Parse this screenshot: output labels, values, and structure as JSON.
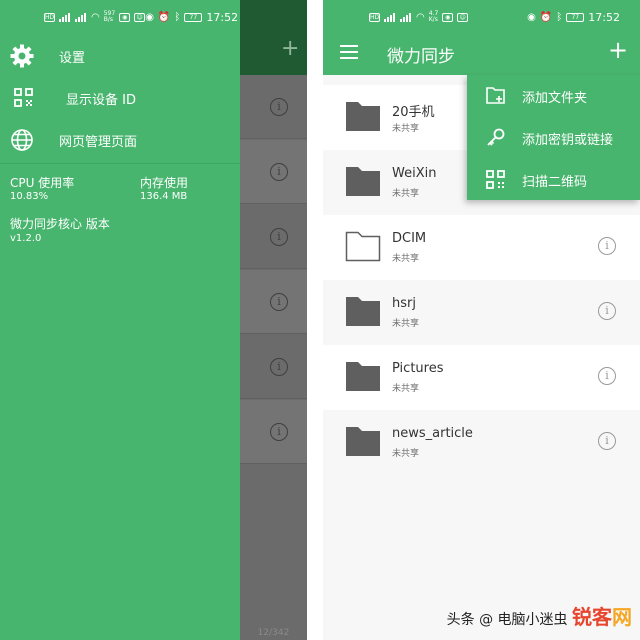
{
  "left_phone": {
    "status_bar": {
      "network_speed": "597\nB/s",
      "battery": "77",
      "time": "17:52"
    },
    "drawer": {
      "menu_items": [
        {
          "icon": "gear-icon",
          "label": "设置"
        },
        {
          "icon": "qr-code-icon",
          "label": "显示设备 ID"
        },
        {
          "icon": "globe-icon",
          "label": "网页管理页面"
        }
      ],
      "stats": {
        "cpu_label": "CPU 使用率",
        "cpu_value": "10.83%",
        "memory_label": "内存使用",
        "memory_value": "136.4 MB",
        "core_label": "微力同步核心 版本",
        "core_value": "v1.2.0"
      }
    },
    "background": {
      "plus_icon": "+",
      "info_icon": "i",
      "page_indicator": "12/342"
    }
  },
  "right_phone": {
    "status_bar": {
      "network_speed": "4.7\nK/s",
      "battery": "77",
      "time": "17:52"
    },
    "app_bar": {
      "title": "微力同步",
      "menu_icon": "hamburger-icon",
      "add_icon": "+"
    },
    "popup_menu": [
      {
        "icon": "add-folder-icon",
        "label": "添加文件夹"
      },
      {
        "icon": "key-icon",
        "label": "添加密钥或链接"
      },
      {
        "icon": "qr-scan-icon",
        "label": "扫描二维码"
      }
    ],
    "folders": [
      {
        "name": "20手机",
        "status": "未共享",
        "icon": "folder-filled-icon"
      },
      {
        "name": "WeiXin",
        "status": "未共享",
        "icon": "folder-filled-icon"
      },
      {
        "name": "DCIM",
        "status": "未共享",
        "icon": "folder-outline-icon"
      },
      {
        "name": "hsrj",
        "status": "未共享",
        "icon": "folder-filled-icon"
      },
      {
        "name": "Pictures",
        "status": "未共享",
        "icon": "folder-filled-icon"
      },
      {
        "name": "news_article",
        "status": "未共享",
        "icon": "folder-filled-icon"
      }
    ],
    "info_icon": "i"
  },
  "watermark": {
    "prefix": "头条",
    "at": "@",
    "author": "电脑小迷虫",
    "brand_part1": "锐客",
    "brand_part2": "网"
  },
  "colors": {
    "accent_green": "#48b56e",
    "dim_overlay": "#6e6e6e",
    "folder_grey": "#5f5f5f"
  }
}
